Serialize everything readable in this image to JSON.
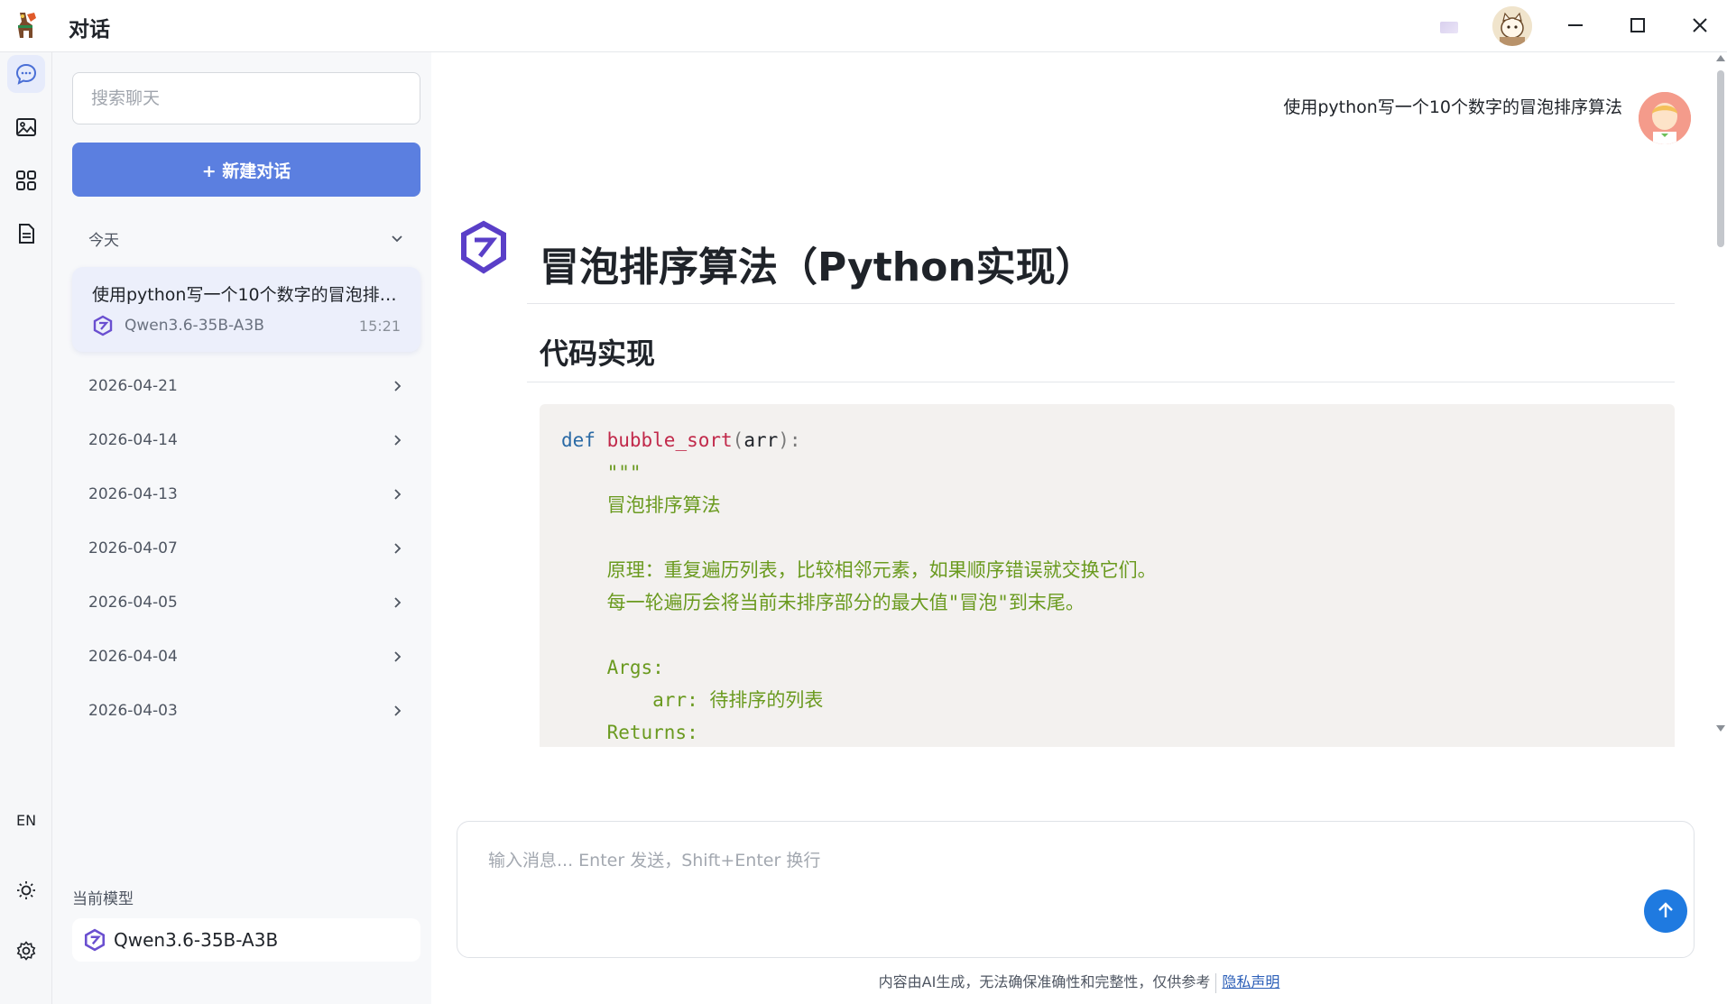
{
  "window": {
    "title": "对话"
  },
  "sidebar": {
    "search_placeholder": "搜索聊天",
    "new_chat_label": "+ 新建对话",
    "today_label": "今天",
    "active_conversation": {
      "title": "使用python写一个10个数字的冒泡排序算法",
      "model": "Qwen3.6-35B-A3B",
      "time": "15:21"
    },
    "date_groups": [
      "2026-04-21",
      "2026-04-14",
      "2026-04-13",
      "2026-04-07",
      "2026-04-05",
      "2026-04-04",
      "2026-04-03"
    ],
    "current_model_label": "当前模型",
    "current_model": "Qwen3.6-35B-A3B"
  },
  "rail": {
    "lang_label": "EN"
  },
  "chat": {
    "user_message": "使用python写一个10个数字的冒泡排序算法",
    "answer": {
      "heading": "冒泡排序算法（Python实现）",
      "subheading": "代码实现",
      "code": {
        "kw_def": "def",
        "fn_name": "bubble_sort",
        "paren_open": "(",
        "param": "arr",
        "paren_close": "):",
        "doc_quote": "\"\"\"",
        "doc_title": "冒泡排序算法",
        "doc_principle": "原理：重复遍历列表，比较相邻元素，如果顺序错误就交换它们。",
        "doc_detail": "每一轮遍历会将当前未排序部分的最大值\"冒泡\"到末尾。",
        "doc_args": "Args:",
        "doc_arg_name": "arr:",
        "doc_arg_desc": "待排序的列表",
        "doc_returns": "Returns:"
      }
    },
    "input_placeholder": "输入消息... Enter 发送，Shift+Enter 换行",
    "footer_notice": "内容由AI生成，无法确保准确性和完整性，仅供参考",
    "footer_link": "隐私声明"
  },
  "colors": {
    "accent": "#5b7fe0",
    "send": "#1f7ae0",
    "active_bg": "#eceffb"
  }
}
